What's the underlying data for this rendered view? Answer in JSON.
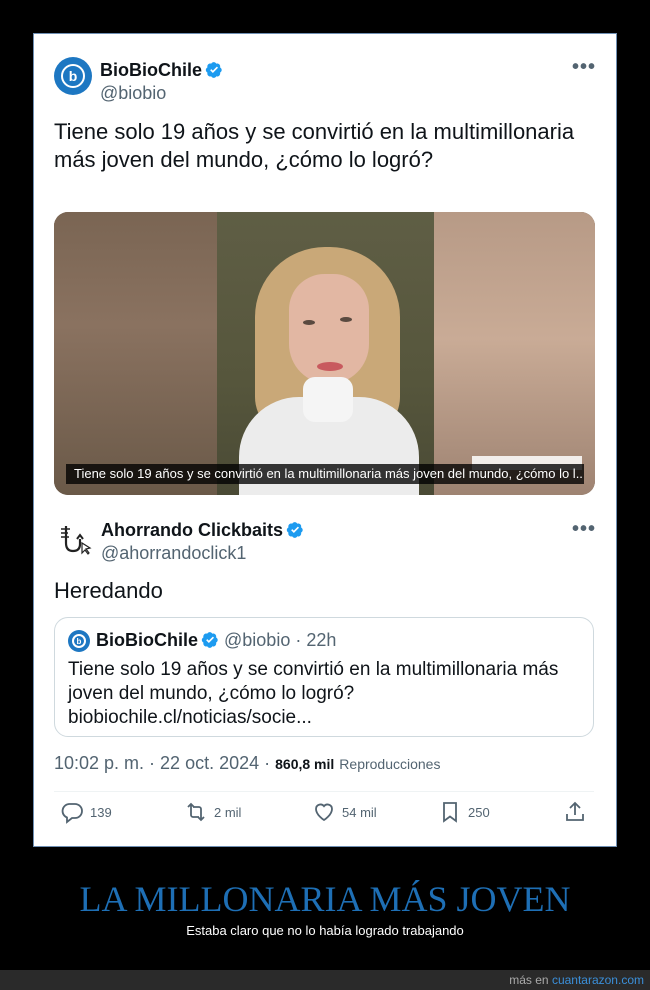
{
  "tweet": {
    "author_name": "BioBioChile",
    "author_handle": "@biobio",
    "more_label": "•••",
    "text": "Tiene solo 19 años y se convirtió en la multimillonaria más joven del mundo, ¿cómo lo logró?",
    "media_caption": "Tiene solo 19 años y se convirtió en la multimillonaria más joven del mundo, ¿cómo lo l..."
  },
  "reply": {
    "author_name": "Ahorrando Clickbaits",
    "author_handle": "@ahorrandoclick1",
    "more_label": "•••",
    "text": "Heredando",
    "quote": {
      "author_name": "BioBioChile",
      "author_handle": "@biobio · 22h",
      "text": "Tiene solo 19 años y se convirtió en la multimillonaria más joven del mundo, ¿cómo lo logró? biobiochile.cl/noticias/socie..."
    },
    "meta": {
      "time": "10:02 p. m. · 22 oct. 2024 · ",
      "views": "860,8 mil",
      "views_label": "Reproducciones"
    },
    "actions": {
      "replies": "139",
      "retweets": "2 mil",
      "likes": "54 mil",
      "bookmarks": "250"
    }
  },
  "footer": {
    "title": "LA MILLONARIA MÁS JOVEN",
    "subtitle": "Estaba claro que no lo había logrado trabajando",
    "more_prefix": "más en ",
    "site_link": "cuantarazon.com"
  },
  "colors": {
    "accent_blue": "#1d9bf0",
    "footer_title": "#1e6fb5"
  }
}
